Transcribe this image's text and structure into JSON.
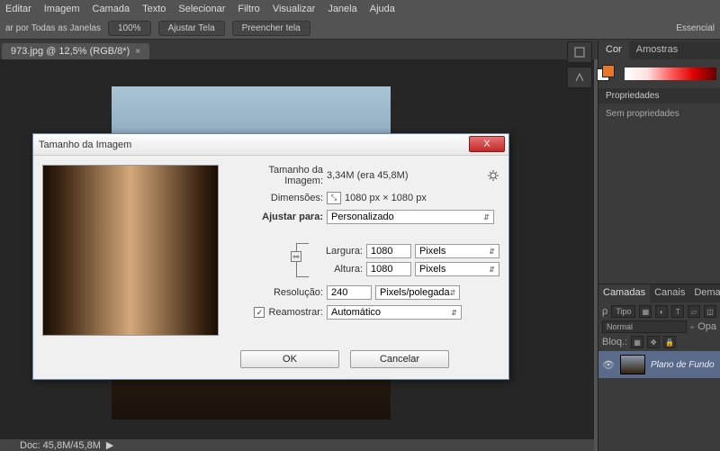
{
  "menu": {
    "items": [
      "Editar",
      "Imagem",
      "Camada",
      "Texto",
      "Selecionar",
      "Filtro",
      "Visualizar",
      "Janela",
      "Ajuda"
    ]
  },
  "options": {
    "label": "ar por Todas as Janelas",
    "btn_zoom": "100%",
    "btn_fit": "Ajustar Tela",
    "btn_fill": "Preencher tela",
    "workspace": "Essencial"
  },
  "doc_tab": {
    "title": "973.jpg @ 12,5% (RGB/8*)",
    "close": "×"
  },
  "status": {
    "doc_label": "Doc: 45,8M/45,8M",
    "zoom": ""
  },
  "right": {
    "cor_tab": "Cor",
    "amostras_tab": "Amostras",
    "props_tab": "Propriedades",
    "props_body": "Sem propriedades",
    "layers": {
      "tabs": [
        "Camadas",
        "Canais",
        "Demarcadores"
      ],
      "tipo": "Tipo",
      "mode": "Normal",
      "opacity": "Opa",
      "bloq": "Bloq.:",
      "layer_name": "Plano de Fundo"
    }
  },
  "dialog": {
    "title": "Tamanho da Imagem",
    "size_label": "Tamanho da Imagem:",
    "size_value": "3,34M (era 45,8M)",
    "dims_label": "Dimensões:",
    "dims_value": "1080 px  ×  1080 px",
    "fit_label": "Ajustar para:",
    "fit_value": "Personalizado",
    "width_label": "Largura:",
    "width_value": "1080",
    "height_label": "Altura:",
    "height_value": "1080",
    "px_unit": "Pixels",
    "res_label": "Resolução:",
    "res_value": "240",
    "res_unit": "Pixels/polegada",
    "resample_label": "Reamostrar:",
    "resample_value": "Automático",
    "ok": "OK",
    "cancel": "Cancelar",
    "close_x": "X"
  }
}
